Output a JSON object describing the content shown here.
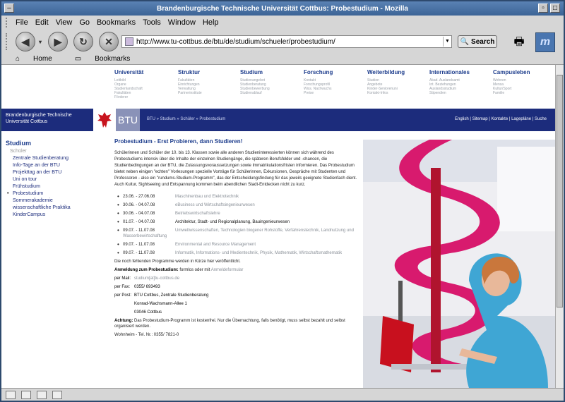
{
  "window": {
    "title": "Brandenburgische Technische Universität Cottbus: Probestudium - Mozilla"
  },
  "menu": {
    "items": [
      "File",
      "Edit",
      "View",
      "Go",
      "Bookmarks",
      "Tools",
      "Window",
      "Help"
    ]
  },
  "toolbar": {
    "url": "http://www.tu-cottbus.de/btu/de/studium/schueler/probestudium/",
    "search_label": "Search"
  },
  "bookmarks": {
    "home_label": "Home",
    "bookmarks_label": "Bookmarks"
  },
  "site": {
    "topnav": [
      {
        "head": "Universität",
        "subs": [
          "Leitbild",
          "Organe",
          "Studienlandschaft",
          "Fakultäten",
          "Förderer"
        ]
      },
      {
        "head": "Struktur",
        "subs": [
          "Fakultäten",
          "Einrichtungen",
          "Verwaltung",
          "Partnerinstitute"
        ]
      },
      {
        "head": "Studium",
        "subs": [
          "Studienangebot",
          "Studienberatung",
          "Studienbewerbung",
          "Studienablauf"
        ]
      },
      {
        "head": "Forschung",
        "subs": [
          "Kontakt",
          "Forschungsprofil",
          "Wiss. Nachwuchs",
          "Preise"
        ]
      },
      {
        "head": "Weiterbildung",
        "subs": [
          "Studien",
          "Angebote",
          "Kinder-Seniorenuni",
          "Kontakt-Infos"
        ]
      },
      {
        "head": "Internationales",
        "subs": [
          "Akad. Auslandsamt",
          "Int. Beziehungen",
          "Auslandsstudium",
          "Stipendien"
        ]
      },
      {
        "head": "Campusleben",
        "subs": [
          "Wohnen",
          "Mensa",
          "Kultur/Sport",
          "Familie"
        ]
      }
    ],
    "banner": {
      "univ_line1": "Brandenburgische Technische",
      "univ_line2": "Universität Cottbus",
      "btu": "BTU",
      "crumb": "BTU » Studium » Schüler » Probestudium",
      "links": "English | Sitemap | Kontakte | Lagepläne | Suche"
    },
    "sidebar": {
      "head": "Studium",
      "sub": "Schüler",
      "items": [
        "Zentrale Studienberatung",
        "Info-Tage an der BTU",
        "Projekttag an der BTU",
        "Uni on tour",
        "Frühstudium",
        "Probestudium",
        "Sommerakademie",
        "wissenschaftliche Praktika",
        "KinderCampus"
      ]
    },
    "main": {
      "title": "Probestudium - Erst Probieren, dann Studieren!",
      "intro": "Schülerinnen und Schüler der 10. bis 13. Klassen sowie alle anderen Studieninteressierten können sich während des Probestudiums intensiv über die Inhalte der einzelnen Studiengänge, die späteren Berufsfelder und -chancen, die Studienbedingungen an der BTU, die Zulassungsvoraussetzungen sowie Immatrikulationsfristen informieren. Das Probestudium bietet neben einigen \"echten\" Vorlesungen spezielle Vorträge für Schülerinnen, Exkursionen, Gespräche mit Studenten und Professoren - also ein \"rundums-Studium-Programm\", das der Entscheidungsfindung für das jeweils geeignete Studienfach dient. Auch Kultur, Sightseeing und Entspannung kommen beim abendlichen Stadt-Entdecken nicht zu kurz.",
      "events": [
        {
          "date": "23.06. - 27.06.08",
          "prog": "Maschinenbau und Elektrotechnik"
        },
        {
          "date": "30.06. - 04.07.08",
          "prog": "eBusiness und Wirtschaftsingenieurwesen"
        },
        {
          "date": "30.06. - 04.07.08",
          "prog": "Betriebswirtschaftslehre"
        },
        {
          "date": "01.07. - 04.07.08",
          "prog": "Architektur, Stadt- und Regionalplanung, Bauingenieurwesen"
        },
        {
          "date": "09.07. - 11.07.08",
          "prog": "Umweltwissenschaften, Technologien biogener Rohstoffe, Verfahrenstechnik, Landnutzung und Wasserbewirtschaftung"
        },
        {
          "date": "09.07. - 11.07.08",
          "prog": "Environmental and Resource Management"
        },
        {
          "date": "09.07. - 11.07.08",
          "prog": "Informatik, Informations- und Medientechnik, Physik, Mathematik, Wirtschaftsmathematik"
        }
      ],
      "note": "Die noch fehlenden Programme werden in Kürze hier veröffentlicht.",
      "anmeldung_label": "Anmeldung zum Probestudium:",
      "anmeldung_text": "formlos oder mit",
      "anmeldung_link": "Anmeldeformular",
      "mail_label": "per Mail:",
      "mail_value": "studium[at]tu-cottbus.de",
      "fax_label": "per Fax:",
      "fax_value": "0355/ 693493",
      "post_label": "per Post:",
      "post_line1": "BTU Cottbus, Zentrale Studienberatung",
      "post_line2": "Konrad-Wachsmann-Allee 1",
      "post_line3": "03046 Cottbus",
      "achtung_label": "Achtung:",
      "achtung_text": "Das Probestudium-Programm ist kostenfrei. Nur die Übernachtung, falls benötigt, muss selbst bezahlt und selbst organisiert werden.",
      "wohnheim": "Wohnheim - Tel. Nr.: 0355/ 7821-0"
    }
  }
}
